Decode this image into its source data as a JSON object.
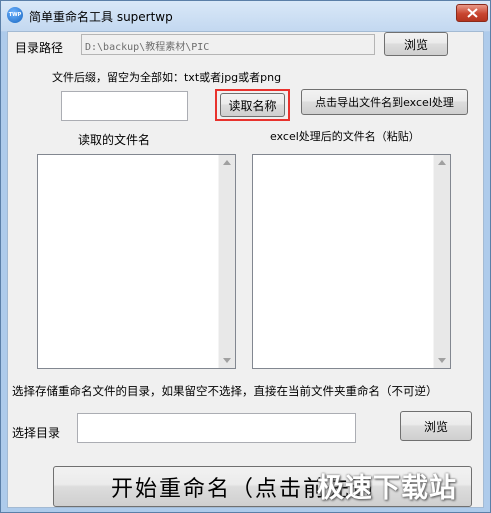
{
  "window": {
    "title": "简单重命名工具 supertwp",
    "icon_text": "TWP"
  },
  "directory": {
    "label": "目录路径",
    "path_value": "D:\\backup\\教程素材\\PIC",
    "browse_label": "浏览"
  },
  "suffix": {
    "hint": "文件后缀，留空为全部如：txt或者jpg或者png",
    "value": ""
  },
  "buttons": {
    "read_names": "读取名称",
    "export_excel": "点击导出文件名到excel处理",
    "start_rename": "开始重命名（点击前先遇"
  },
  "lists": {
    "read_label": "读取的文件名",
    "excel_label": "excel处理后的文件名（粘贴）"
  },
  "target": {
    "description": "选择存储重命名文件的目录，如果留空不选择，直接在当前文件夹重命名（不可逆）",
    "label": "选择目录",
    "value": "",
    "browse_label": "浏览"
  },
  "watermark": "极速下载站",
  "colors": {
    "highlight": "#e8322d",
    "close_button": "#c8452f"
  }
}
